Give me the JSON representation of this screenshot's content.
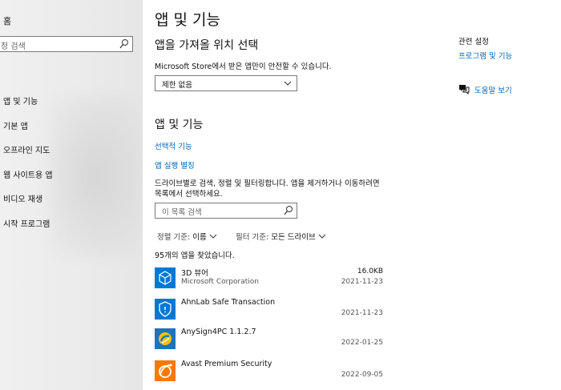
{
  "sidebar": {
    "home": "홈",
    "search_placeholder": "정 검색",
    "items": [
      {
        "label": "앱 및 기능"
      },
      {
        "label": "기본 앱"
      },
      {
        "label": "오프라인 지도"
      },
      {
        "label": "웹 사이트용 앱"
      },
      {
        "label": "비디오 재생"
      },
      {
        "label": "시작 프로그램"
      }
    ]
  },
  "main": {
    "title": "앱 및 기능",
    "install_section": {
      "title": "앱을 가져올 위치 선택",
      "description": "Microsoft Store에서 받은 앱만이 안전할 수 있습니다.",
      "dropdown_value": "제한 없음"
    },
    "apps_section": {
      "title": "앱 및 기능",
      "optional_features_link": "선택적 기능",
      "aliases_link": "앱 실행 별칭",
      "description_line1": "드라이브별로 검색, 정렬 및 필터링합니다. 앱을 제거하거나 이동하려면",
      "description_line2": "목록에서 선택하세요.",
      "search_placeholder": "이 목록 검색",
      "sort_label": "정렬 기준:",
      "sort_value": "이름",
      "filter_label": "필터 기준:",
      "filter_value": "모든 드라이브",
      "count_text": "95개의 앱을 찾았습니다."
    },
    "apps": [
      {
        "name": "3D 뷰어",
        "publisher": "Microsoft Corporation",
        "size": "16.0KB",
        "date": "2021-11-23",
        "icon": "cube-icon",
        "color": "#0078d7"
      },
      {
        "name": "AhnLab Safe Transaction",
        "publisher": "",
        "size": "",
        "date": "2021-11-23",
        "icon": "shield-icon",
        "color": "#0078d7"
      },
      {
        "name": "AnySign4PC 1.1.2.7",
        "publisher": "",
        "size": "",
        "date": "2022-01-25",
        "icon": "anysign-icon",
        "color": "#1e73be"
      },
      {
        "name": "Avast Premium Security",
        "publisher": "",
        "size": "",
        "date": "2022-09-05",
        "icon": "avast-icon",
        "color": "#ff7800"
      }
    ]
  },
  "right_panel": {
    "related_title": "관련 설정",
    "programs_link": "프로그램 및 기능",
    "help_label": "도움말 보기"
  },
  "colors": {
    "accent": "#0063b1",
    "sidebar_bg": "#ececec"
  }
}
